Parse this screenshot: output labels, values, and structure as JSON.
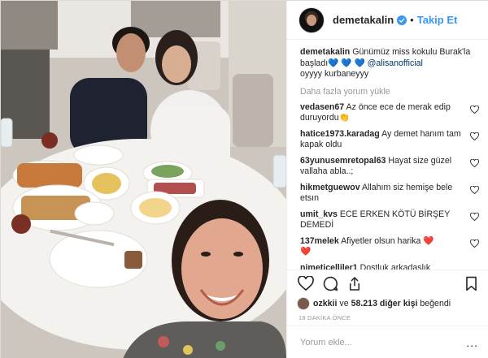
{
  "post": {
    "username": "demetakalin",
    "follow_label": "Takip Et",
    "dot": "•",
    "verified_icon": "verified-badge-icon",
    "accent": "#3897f0"
  },
  "caption": {
    "username": "demetakalin",
    "text_before": "Günümüz miss kokulu Burak'la başladı",
    "hearts": "💙 💙 💙",
    "mention": "@alisanofficial",
    "text_after": "oyyyy kurbaneyyy"
  },
  "load_more": "Daha fazla yorum yükle",
  "comments": [
    {
      "user": "vedasen67",
      "text": "Az önce ece de merak edip duruyordu👏"
    },
    {
      "user": "hatice1973.karadag",
      "text": "Ay demet hanım tam kapak oldu"
    },
    {
      "user": "63yunusemretopal63",
      "text": "Hayat size güzel vallaha abla..;"
    },
    {
      "user": "hikmetguewov",
      "text": "Allahım siz hemişe bele etsın"
    },
    {
      "user": "umit_kvs",
      "text": "ECE ERKEN KÖTÜ BİRŞEY DEMEDİ"
    },
    {
      "user": "137melek",
      "text": "Afiyetler olsun harika",
      "tail": "❤️",
      "tail2": "❤️"
    },
    {
      "user": "nimeticelliler1",
      "text": "Dostluk arkadaşlık"
    }
  ],
  "likes": {
    "user": "ozkkii",
    "middle": "ve",
    "count": "58.213 diğer kişi",
    "suffix": "beğendi"
  },
  "timestamp": "18 DAKİKA ÖNCE",
  "add_comment": {
    "placeholder": "Yorum ekle...",
    "more": "..."
  },
  "icons": [
    "heart-icon",
    "comment-icon",
    "share-icon",
    "bookmark-icon",
    "like-heart-icon"
  ],
  "colors": {
    "like_red": "#ed4956",
    "muted": "#999999",
    "mention": "#003569"
  }
}
